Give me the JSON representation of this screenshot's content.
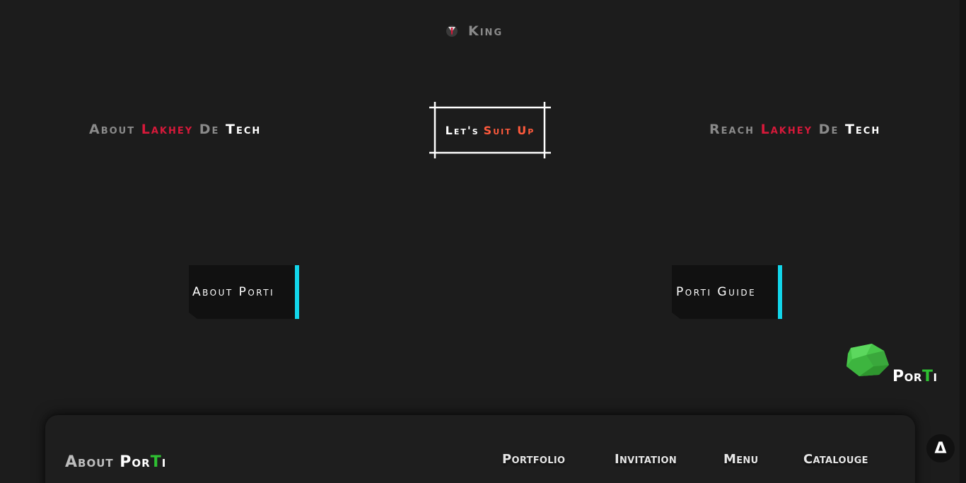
{
  "brand": {
    "name": "King",
    "logo_icon": "suit-tie-icon"
  },
  "nav": {
    "left": {
      "prefix": "About",
      "highlight": "Lakhey",
      "mid": "De",
      "tail": "Tech"
    },
    "center": {
      "first": "Let's",
      "accent": "Suit Up"
    },
    "right": {
      "prefix": "Reach",
      "highlight": "Lakhey",
      "mid": "De",
      "tail": "Tech"
    }
  },
  "cards": {
    "about": {
      "label": "About Porti"
    },
    "guide": {
      "label": "Porti Guide"
    }
  },
  "porti_logo": {
    "part1": "Por",
    "part2": "T",
    "part3": "i",
    "icon": "gem-icon"
  },
  "footer": {
    "title_first": "About",
    "title_second": "Por",
    "title_third": "T",
    "title_fourth": "i",
    "nav": [
      "Portfolio",
      "Invitation",
      "Menu",
      "Catalouge"
    ]
  },
  "scroll_top": {
    "label": "Δ"
  },
  "colors": {
    "background": "#1c1c1c",
    "accent_red": "#d6193a",
    "accent_orange": "#ff5a3c",
    "accent_cyan": "#12d6ea",
    "accent_green": "#2ec132"
  }
}
